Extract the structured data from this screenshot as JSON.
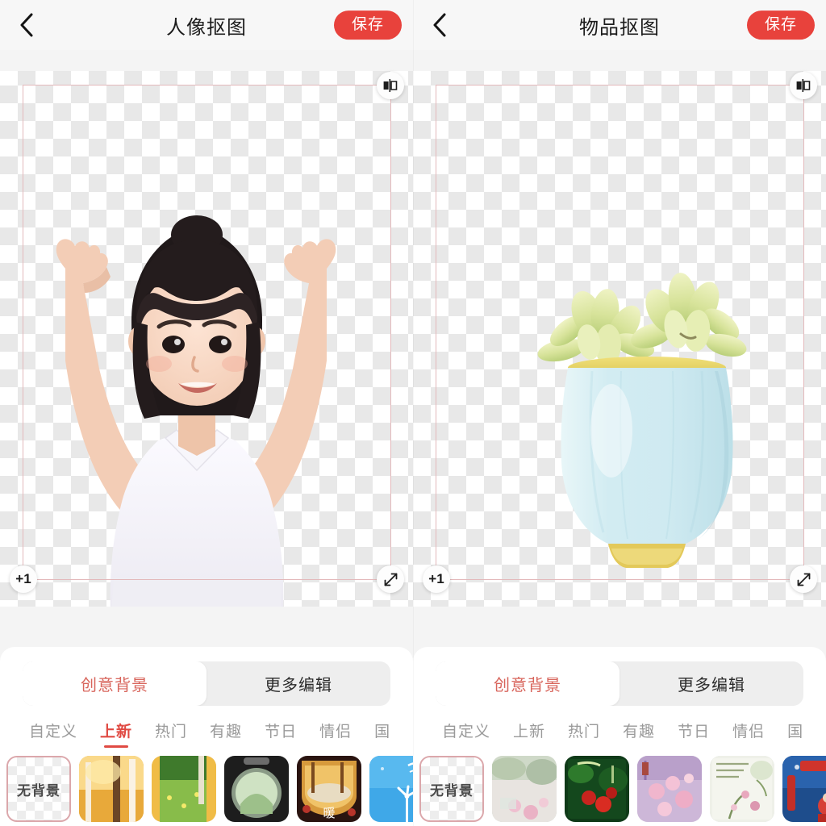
{
  "panels": [
    {
      "id": "portrait-cutout",
      "header": {
        "back_icon": "chevron-left-icon",
        "title": "人像抠图",
        "save_label": "保存"
      },
      "canvas": {
        "flip_handle_icon": "flip-horizontal-icon",
        "add_layer_label": "+1",
        "resize_handle_icon": "diagonal-resize-icon",
        "subject": "girl-arms-raised"
      },
      "segmented": {
        "options": [
          "创意背景",
          "更多编辑"
        ],
        "active_index": 0
      },
      "categories": {
        "items": [
          "自定义",
          "上新",
          "热门",
          "有趣",
          "节日",
          "情侣",
          "国"
        ],
        "active_index": 1
      },
      "thumbnails": [
        {
          "name": "无背景",
          "kind": "none",
          "selected": true
        },
        {
          "name": "autumn-birch-forest",
          "kind": "image"
        },
        {
          "name": "green-meadow-trees",
          "kind": "image"
        },
        {
          "name": "round-window-garden",
          "kind": "image"
        },
        {
          "name": "warm-autumn-path",
          "kind": "image"
        },
        {
          "name": "blue-windmill-sky",
          "kind": "image"
        }
      ]
    },
    {
      "id": "object-cutout",
      "header": {
        "back_icon": "chevron-left-icon",
        "title": "物品抠图",
        "save_label": "保存"
      },
      "canvas": {
        "flip_handle_icon": "flip-horizontal-icon",
        "add_layer_label": "+1",
        "resize_handle_icon": "diagonal-resize-icon",
        "subject": "succulent-in-blue-pot"
      },
      "segmented": {
        "options": [
          "创意背景",
          "更多编辑"
        ],
        "active_index": 0
      },
      "categories": {
        "items": [
          "自定义",
          "上新",
          "热门",
          "有趣",
          "节日",
          "情侣",
          "国"
        ],
        "active_index": -1
      },
      "thumbnails": [
        {
          "name": "无背景",
          "kind": "none",
          "selected": true
        },
        {
          "name": "misty-pink-blossom",
          "kind": "image"
        },
        {
          "name": "red-roses-dark-green",
          "kind": "image"
        },
        {
          "name": "purple-cherry-blossom",
          "kind": "image"
        },
        {
          "name": "pale-floral-verse",
          "kind": "image"
        },
        {
          "name": "blue-new-year-poster",
          "kind": "image"
        }
      ]
    }
  ],
  "colors": {
    "accent_red": "#e8423c",
    "tab_active_red": "#e04a43",
    "segment_active_text": "#d8655c",
    "crop_frame": "#e3b9bb",
    "sheet_bg": "#ffffff",
    "canvas_bg": "#f4f4f4"
  }
}
